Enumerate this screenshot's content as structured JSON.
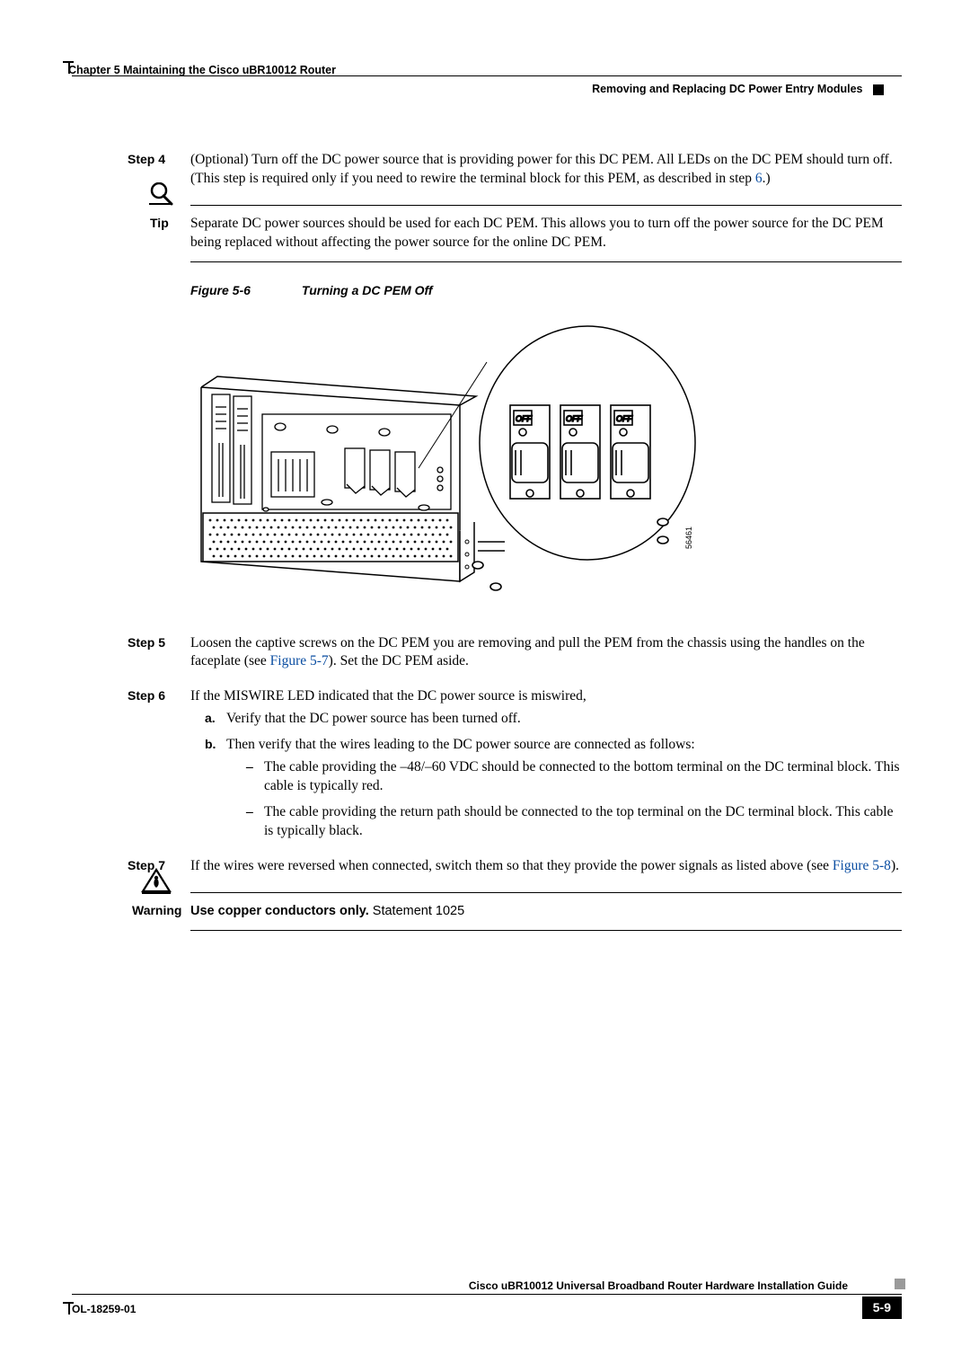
{
  "header": {
    "chapter": "Chapter 5      Maintaining the Cisco uBR10012 Router",
    "section": "Removing and Replacing DC Power Entry Modules"
  },
  "steps": {
    "s4": {
      "label": "Step 4",
      "text_a": "(Optional) Turn off the DC power source that is providing power for this DC PEM. All LEDs on the DC PEM should turn off. (This step is required only if you need to rewire the terminal block for this PEM, as described in step ",
      "link": "6",
      "text_b": ".)"
    },
    "s5": {
      "label": "Step 5",
      "text_a": "Loosen the captive screws on the DC PEM you are removing and pull the PEM from the chassis using the handles on the faceplate (see ",
      "link": "Figure 5-7",
      "text_b": "). Set the DC PEM aside."
    },
    "s6": {
      "label": "Step 6",
      "text": "If the MISWIRE LED indicated that the DC power source is miswired,",
      "a_marker": "a.",
      "a_text": "Verify that the DC power source has been turned off.",
      "b_marker": "b.",
      "b_text": "Then verify that the wires leading to the DC power source are connected as follows:",
      "dash1": "The cable providing the –48/–60 VDC should be connected to the bottom terminal on the DC terminal block. This cable is typically red.",
      "dash2": "The cable providing the return path should be connected to the top terminal on the DC terminal block. This cable is typically black."
    },
    "s7": {
      "label": "Step 7",
      "text_a": "If the wires were reversed when connected, switch them so that they provide the power signals as listed above (see ",
      "link": "Figure 5-8",
      "text_b": ")."
    }
  },
  "tip": {
    "label": "Tip",
    "text": "Separate DC power sources should be used for each DC PEM. This allows you to turn off the power source for the DC PEM being replaced without affecting the power source for the online DC PEM."
  },
  "figure": {
    "num": "Figure 5-6",
    "title": "Turning a DC PEM Off",
    "artnum": "56461"
  },
  "warning": {
    "label": "Warning",
    "bold": "Use copper conductors only.",
    "rest": " Statement 1025"
  },
  "footer": {
    "title": "Cisco uBR10012 Universal Broadband Router Hardware Installation Guide",
    "doc": "OL-18259-01",
    "page": "5-9"
  }
}
